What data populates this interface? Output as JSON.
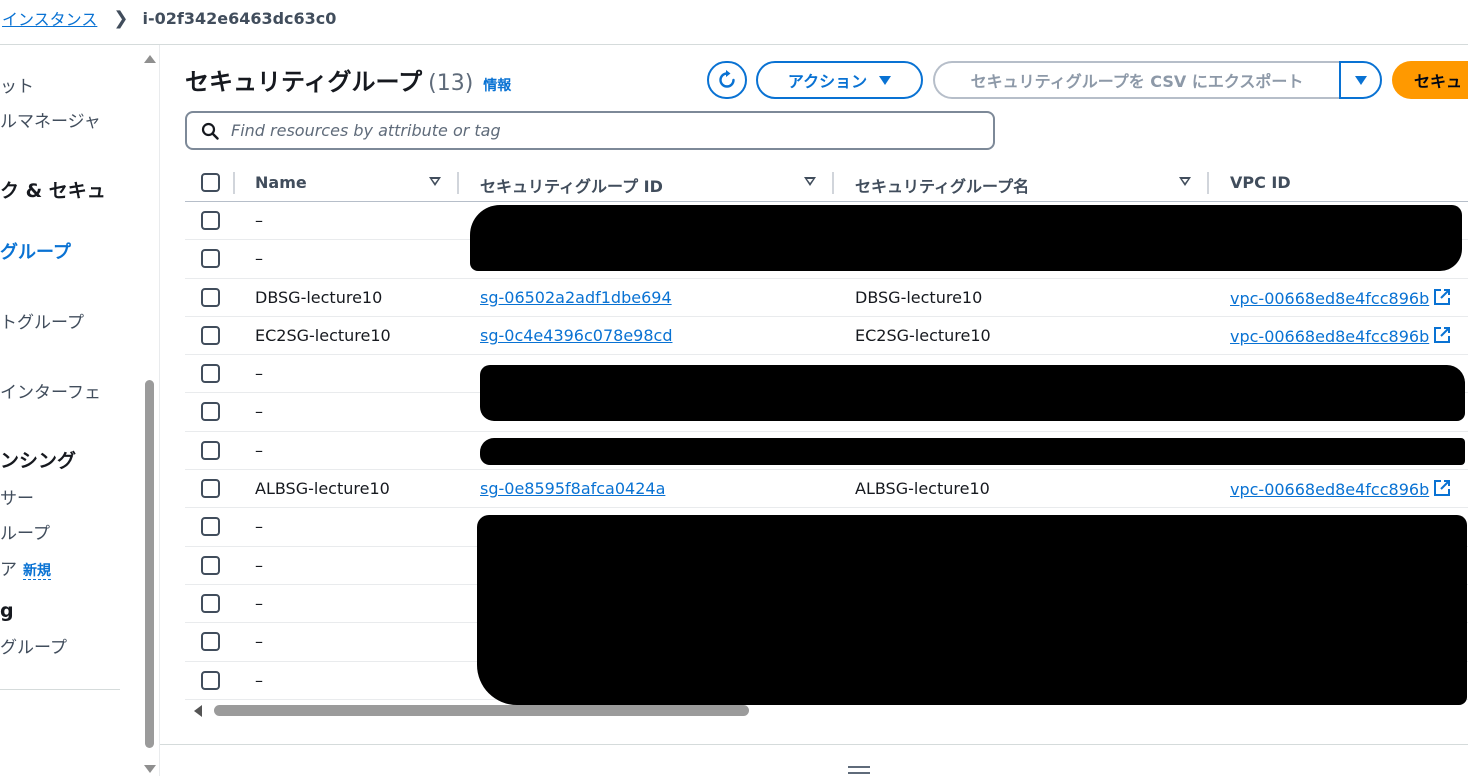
{
  "breadcrumb": {
    "parent": "インスタンス",
    "current": "i-02f342e6463dc63c0"
  },
  "sidebar": {
    "items": [
      {
        "label": "ット",
        "kind": "normal"
      },
      {
        "label": "ルマネージャ",
        "kind": "normal"
      },
      {
        "label": "ク & セキュ",
        "kind": "heading"
      },
      {
        "label": "グループ",
        "kind": "active"
      },
      {
        "label": "トグループ",
        "kind": "normal"
      },
      {
        "label": "インターフェ",
        "kind": "normal"
      },
      {
        "label": "ンシング",
        "kind": "heading"
      },
      {
        "label": "サー",
        "kind": "normal"
      },
      {
        "label": "ループ",
        "kind": "normal"
      },
      {
        "label": "ア",
        "kind": "normal",
        "badge": "新規"
      },
      {
        "label": "g",
        "kind": "heading"
      },
      {
        "label": "グループ",
        "kind": "normal"
      }
    ]
  },
  "header": {
    "title": "セキュリティグループ",
    "count": "(13)",
    "info": "情報",
    "actions_label": "アクション",
    "export_label": "セキュリティグループを CSV にエクスポート",
    "create_label": "セキュ"
  },
  "search": {
    "placeholder": "Find resources by attribute or tag"
  },
  "table": {
    "columns": [
      "Name",
      "セキュリティグループ ID",
      "セキュリティグループ名",
      "VPC ID"
    ],
    "rows": [
      {
        "name": "–",
        "sg_id": "",
        "sg_name": "",
        "vpc_id": ""
      },
      {
        "name": "–",
        "sg_id": "",
        "sg_name": "",
        "vpc_id": ""
      },
      {
        "name": "DBSG-lecture10",
        "sg_id": "sg-06502a2adf1dbe694",
        "sg_name": "DBSG-lecture10",
        "vpc_id": "vpc-00668ed8e4fcc896b"
      },
      {
        "name": "EC2SG-lecture10",
        "sg_id": "sg-0c4e4396c078e98cd",
        "sg_name": "EC2SG-lecture10",
        "vpc_id": "vpc-00668ed8e4fcc896b"
      },
      {
        "name": "–",
        "sg_id": "",
        "sg_name": "",
        "vpc_id": ""
      },
      {
        "name": "–",
        "sg_id": "",
        "sg_name": "",
        "vpc_id": ""
      },
      {
        "name": "–",
        "sg_id": "",
        "sg_name": "",
        "vpc_id": ""
      },
      {
        "name": "ALBSG-lecture10",
        "sg_id": "sg-0e8595f8afca0424a",
        "sg_name": "ALBSG-lecture10",
        "vpc_id": "vpc-00668ed8e4fcc896b"
      },
      {
        "name": "–",
        "sg_id": "",
        "sg_name": "",
        "vpc_id": ""
      },
      {
        "name": "–",
        "sg_id": "",
        "sg_name": "",
        "vpc_id": ""
      },
      {
        "name": "–",
        "sg_id": "",
        "sg_name": "",
        "vpc_id": ""
      },
      {
        "name": "–",
        "sg_id": "",
        "sg_name": "",
        "vpc_id": ""
      },
      {
        "name": "–",
        "sg_id": "",
        "sg_name": "",
        "vpc_id": ""
      }
    ]
  },
  "colors": {
    "link": "#0972d3",
    "primary": "#ff9900",
    "text": "#16191f",
    "redaction": "#000000"
  }
}
